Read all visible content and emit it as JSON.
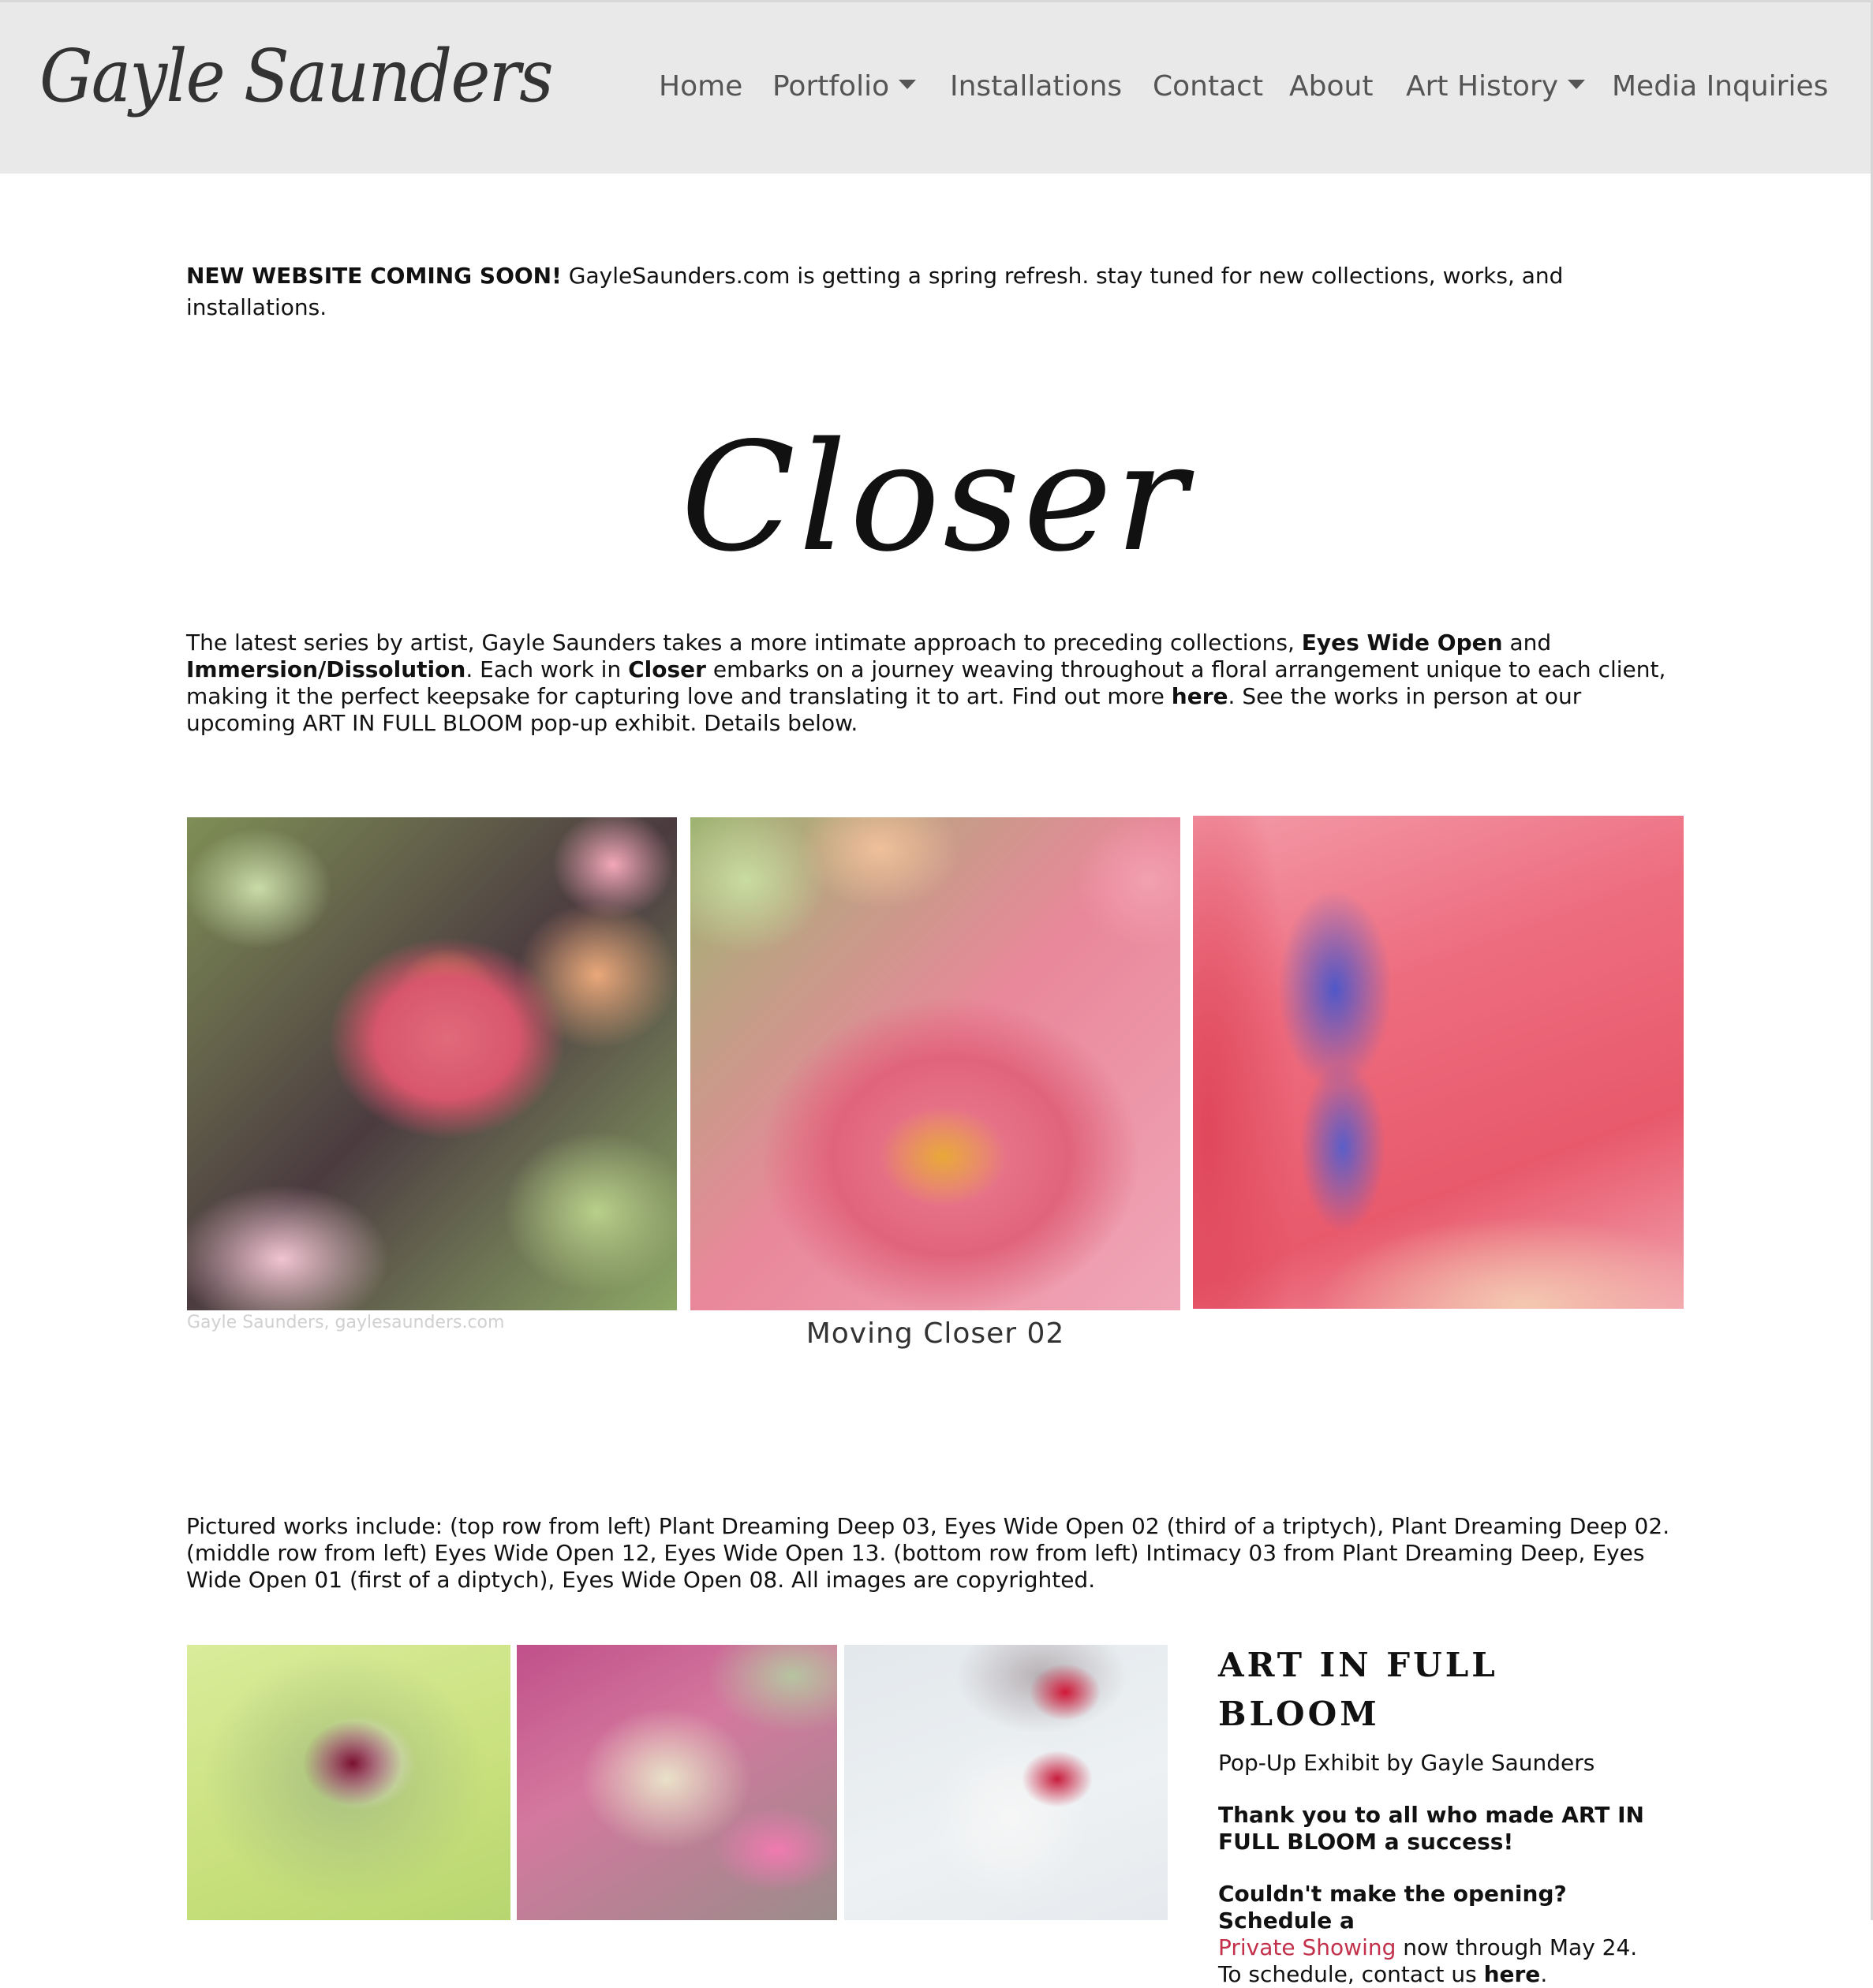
{
  "header": {
    "logo": "Gayle Saunders",
    "nav": [
      {
        "label": "Home",
        "has_dropdown": false
      },
      {
        "label": "Portfolio",
        "has_dropdown": true
      },
      {
        "label": "Installations",
        "has_dropdown": false
      },
      {
        "label": "Contact",
        "has_dropdown": false
      },
      {
        "label": "About",
        "has_dropdown": false
      },
      {
        "label": "Art History",
        "has_dropdown": true
      },
      {
        "label": "Media Inquiries",
        "has_dropdown": false
      }
    ]
  },
  "announcement": {
    "bold": "NEW WEBSITE COMING SOON!",
    "text": " GayleSaunders.com is getting a spring refresh. stay tuned for new collections, works, and installations."
  },
  "closer": {
    "title": "Closer",
    "intro_1": "The latest series by artist, Gayle Saunders takes a more intimate approach to preceding collections, ",
    "eyes_wide_open": "Eyes Wide Open",
    "intro_2": " and ",
    "immersion": "Immersion/Dissolution",
    "intro_3": ". Each work in ",
    "closer_bold": "Closer",
    "intro_4": " embarks on a journey weaving throughout a floral arrangement unique to each client, making it the perfect keepsake for capturing love and translating it to art. Find out more ",
    "here_link": "here",
    "intro_5": ". See the works in person at our upcoming ART IN FULL BLOOM pop-up exhibit. Details below."
  },
  "triptych": {
    "watermark": "Gayle Saunders, gaylesaunders.com",
    "caption": "Moving Closer 02"
  },
  "pictured": "Pictured works include: (top row from left) Plant Dreaming Deep 03, Eyes Wide Open 02 (third of a triptych), Plant Dreaming Deep 02. (middle row from left) Eyes Wide Open 12, Eyes Wide Open 13. (bottom row from left) Intimacy 03 from Plant Dreaming Deep, Eyes Wide Open 01 (first of a diptych), Eyes Wide Open 08. All images are copyrighted.",
  "sidebar": {
    "title": "ART IN FULL BLOOM",
    "subtitle": "Pop-Up Exhibit by Gayle Saunders",
    "thanks": "Thank you to all who made ART IN FULL BLOOM a success!",
    "schedule_1": "Couldn't make the opening? Schedule a",
    "private_link": "Private Showing",
    "schedule_2": "  now through May 24. To schedule, contact us ",
    "here_link": "here",
    "schedule_3": "."
  },
  "colors": {
    "header_bg": "#e9e9e9",
    "nav_text": "#555555",
    "link_accent": "#c2304a"
  }
}
